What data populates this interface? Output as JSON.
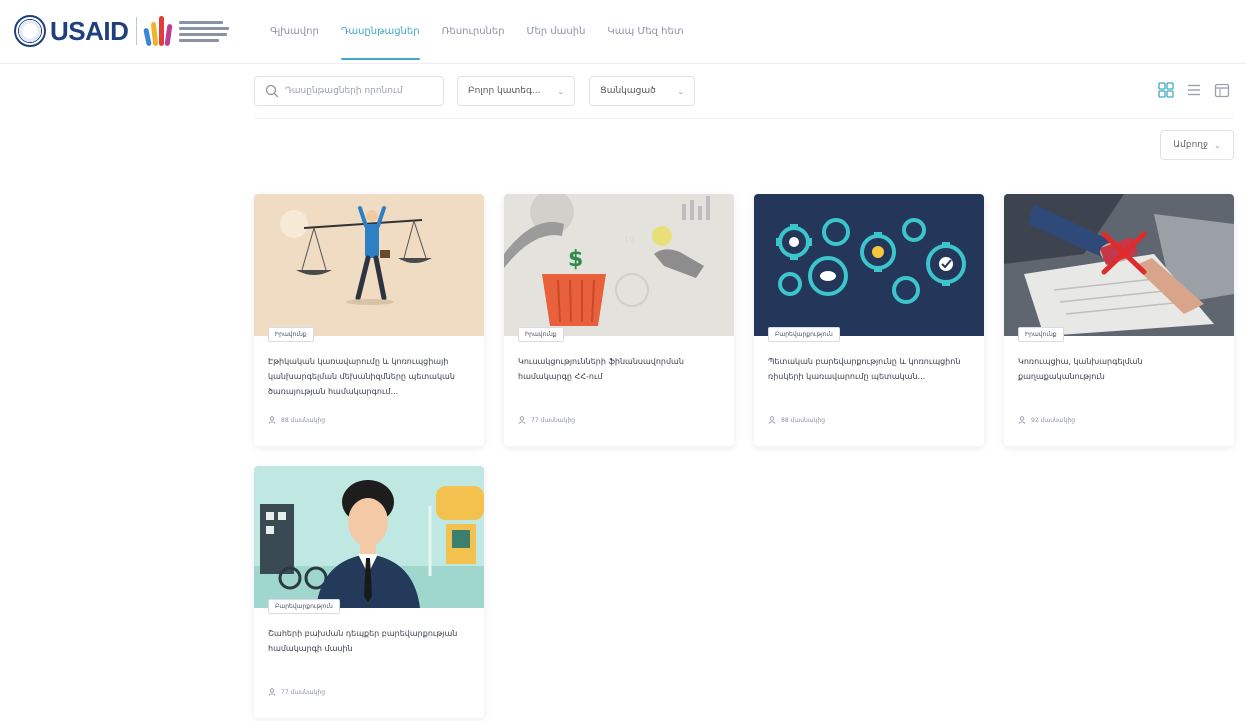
{
  "header": {
    "logo_text": "USAID",
    "nav": [
      {
        "label": "Գլխավոր",
        "active": false
      },
      {
        "label": "Դասընթացներ",
        "active": true
      },
      {
        "label": "Ռեսուրսներ",
        "active": false
      },
      {
        "label": "Մեր մասին",
        "active": false
      },
      {
        "label": "Կապ Մեզ հետ",
        "active": false
      }
    ]
  },
  "filters": {
    "search_placeholder": "Դասընթացների որոնում",
    "category": "Բոլոր կատեգ...",
    "level": "Ցանկացած"
  },
  "language": {
    "label": "Ամբողջ"
  },
  "cards": [
    {
      "tag": "Իրավունք",
      "title": "Էթիկական կառավարումը և կոռուպցիայի կանխարգելման մեխանիզմները պետական ծառայության համակարգում...",
      "meta": "88 մասնակից"
    },
    {
      "tag": "Իրավունք",
      "title": "Կուսակցությունների ֆինանսավորման համակարգը ՀՀ-ում",
      "meta": "77 մասնակից"
    },
    {
      "tag": "Բարեվարքություն",
      "title": "Պետական բարեվարքությունը և կոռուպցիոն ռիսկերի կառավարումը պետական...",
      "meta": "88 մասնակից"
    },
    {
      "tag": "Իրավունք",
      "title": "Կոռուպցիա, կանխարգելման քաղաքականություն",
      "meta": "92 մասնակից"
    },
    {
      "tag": "Բարեվարքություն",
      "title": "Շահերի բախման դեպքեր բարեվարքության համակարգի մասին",
      "meta": "77 մասնակից"
    }
  ],
  "colors": {
    "accent": "#3fa7c9",
    "brand": "#1f3f7f"
  }
}
